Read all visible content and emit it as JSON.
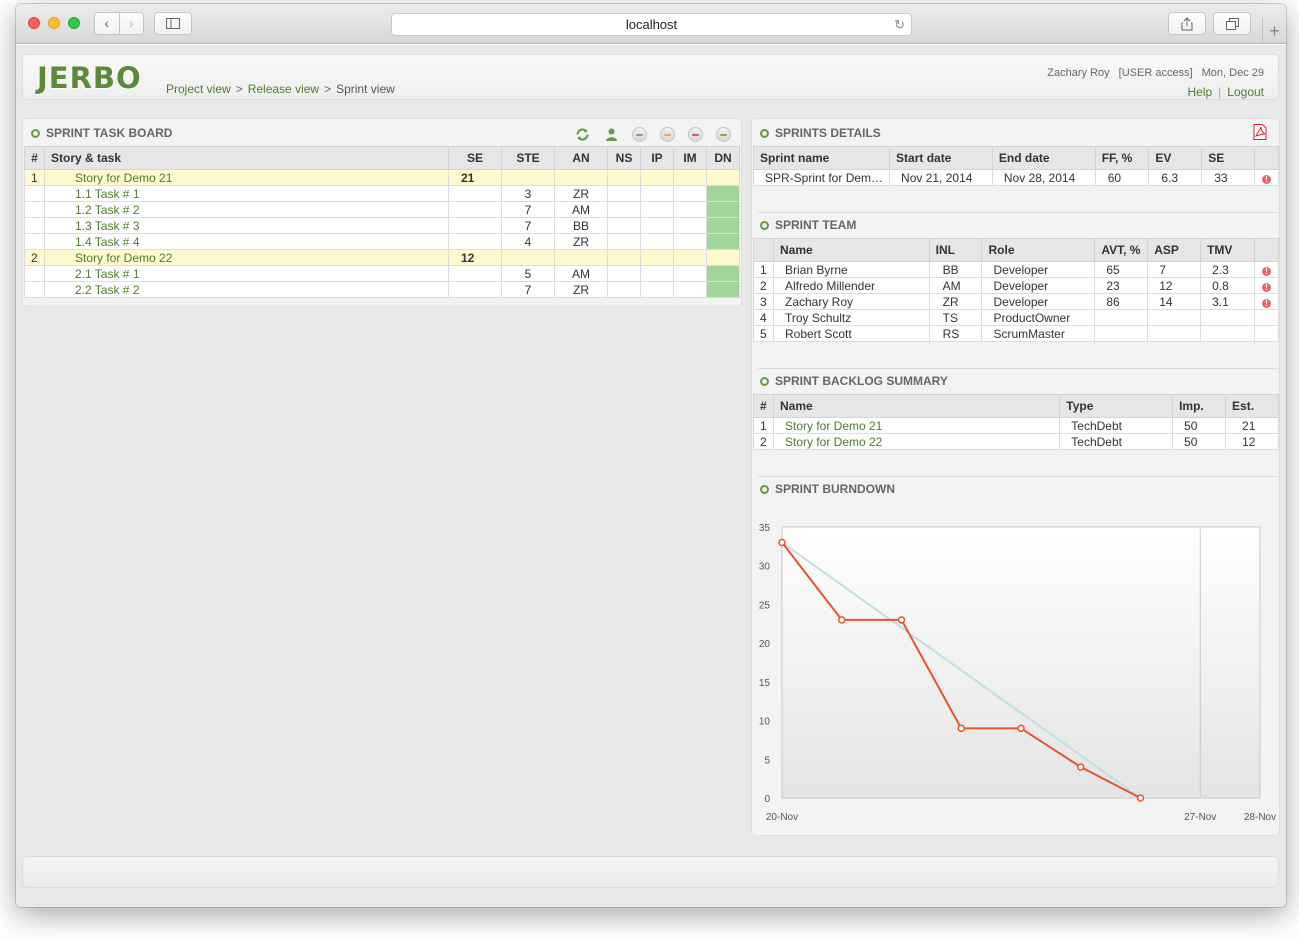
{
  "browser": {
    "url": "localhost"
  },
  "app": {
    "logo": "JERBO",
    "breadcrumb": [
      "Project view",
      "Release view",
      "Sprint view"
    ],
    "breadcrumb_sep": ">",
    "user_name": "Zachary Roy",
    "user_access": "[USER access]",
    "date": "Mon, Dec 29",
    "help": "Help",
    "logout": "Logout"
  },
  "task_board": {
    "title": "SPRINT TASK BOARD",
    "columns": [
      "#",
      "Story & task",
      "SE",
      "STE",
      "AN",
      "NS",
      "IP",
      "IM",
      "DN"
    ],
    "rows": [
      {
        "num": "1",
        "name": "Story for Demo 21",
        "se": "21",
        "ste": "",
        "an": "",
        "story": true
      },
      {
        "num": "",
        "name": "1.1 Task # 1",
        "se": "",
        "ste": "3",
        "an": "ZR",
        "story": false
      },
      {
        "num": "",
        "name": "1.2 Task # 2",
        "se": "",
        "ste": "7",
        "an": "AM",
        "story": false
      },
      {
        "num": "",
        "name": "1.3 Task # 3",
        "se": "",
        "ste": "7",
        "an": "BB",
        "story": false
      },
      {
        "num": "",
        "name": "1.4 Task # 4",
        "se": "",
        "ste": "4",
        "an": "ZR",
        "story": false
      },
      {
        "num": "2",
        "name": "Story for Demo 22",
        "se": "12",
        "ste": "",
        "an": "",
        "story": true
      },
      {
        "num": "",
        "name": "2.1 Task # 1",
        "se": "",
        "ste": "5",
        "an": "AM",
        "story": false
      },
      {
        "num": "",
        "name": "2.2 Task # 2",
        "se": "",
        "ste": "7",
        "an": "ZR",
        "story": false
      }
    ]
  },
  "sprint_details": {
    "title": "SPRINTS DETAILS",
    "columns": [
      "Sprint name",
      "Start date",
      "End date",
      "FF, %",
      "EV",
      "SE"
    ],
    "row": {
      "name": "SPR-Sprint for Dem…",
      "start": "Nov 21, 2014",
      "end": "Nov 28, 2014",
      "ff": "60",
      "ev": "6.3",
      "se": "33"
    }
  },
  "sprint_team": {
    "title": "SPRINT TEAM",
    "columns": [
      "",
      "Name",
      "INL",
      "Role",
      "AVT, %",
      "ASP",
      "TMV"
    ],
    "rows": [
      {
        "num": "1",
        "name": "Brian Byrne",
        "inl": "BB",
        "role": "Developer",
        "avt": "65",
        "asp": "7",
        "tmv": "2.3",
        "warn": true
      },
      {
        "num": "2",
        "name": "Alfredo Millender",
        "inl": "AM",
        "role": "Developer",
        "avt": "23",
        "asp": "12",
        "tmv": "0.8",
        "warn": true
      },
      {
        "num": "3",
        "name": "Zachary Roy",
        "inl": "ZR",
        "role": "Developer",
        "avt": "86",
        "asp": "14",
        "tmv": "3.1",
        "warn": true
      },
      {
        "num": "4",
        "name": "Troy Schultz",
        "inl": "TS",
        "role": "ProductOwner",
        "avt": "",
        "asp": "",
        "tmv": "",
        "warn": false
      },
      {
        "num": "5",
        "name": "Robert Scott",
        "inl": "RS",
        "role": "ScrumMaster",
        "avt": "",
        "asp": "",
        "tmv": "",
        "warn": false
      }
    ]
  },
  "backlog": {
    "title": "SPRINT BACKLOG SUMMARY",
    "columns": [
      "#",
      "Name",
      "Type",
      "Imp.",
      "Est."
    ],
    "rows": [
      {
        "num": "1",
        "name": "Story for Demo 21",
        "type": "TechDebt",
        "imp": "50",
        "est": "21"
      },
      {
        "num": "2",
        "name": "Story for Demo 22",
        "type": "TechDebt",
        "imp": "50",
        "est": "12"
      }
    ]
  },
  "burndown": {
    "title": "SPRINT BURNDOWN"
  },
  "chart_data": {
    "type": "line",
    "title": "",
    "x": [
      "2014-11-20",
      "2014-11-21",
      "2014-11-22",
      "2014-11-23",
      "2014-11-24",
      "2014-11-25",
      "2014-11-26",
      "2014-11-27",
      "2014-11-28"
    ],
    "x_ticks": [
      "20-Nov",
      "27-Nov",
      "28-Nov"
    ],
    "ylim": [
      0,
      35
    ],
    "y_ticks": [
      0,
      5,
      10,
      15,
      20,
      25,
      30,
      35
    ],
    "series": [
      {
        "color": "#e8542a",
        "points": [
          [
            "2014-11-20",
            33
          ],
          [
            "2014-11-21",
            23
          ],
          [
            "2014-11-22",
            23
          ],
          [
            "2014-11-23",
            9
          ],
          [
            "2014-11-24",
            9
          ],
          [
            "2014-11-25",
            4
          ],
          [
            "2014-11-26",
            0
          ]
        ]
      },
      {
        "color": "#bfe0e0",
        "points": [
          [
            "2014-11-20",
            33
          ],
          [
            "2014-11-26",
            0
          ]
        ]
      }
    ]
  }
}
